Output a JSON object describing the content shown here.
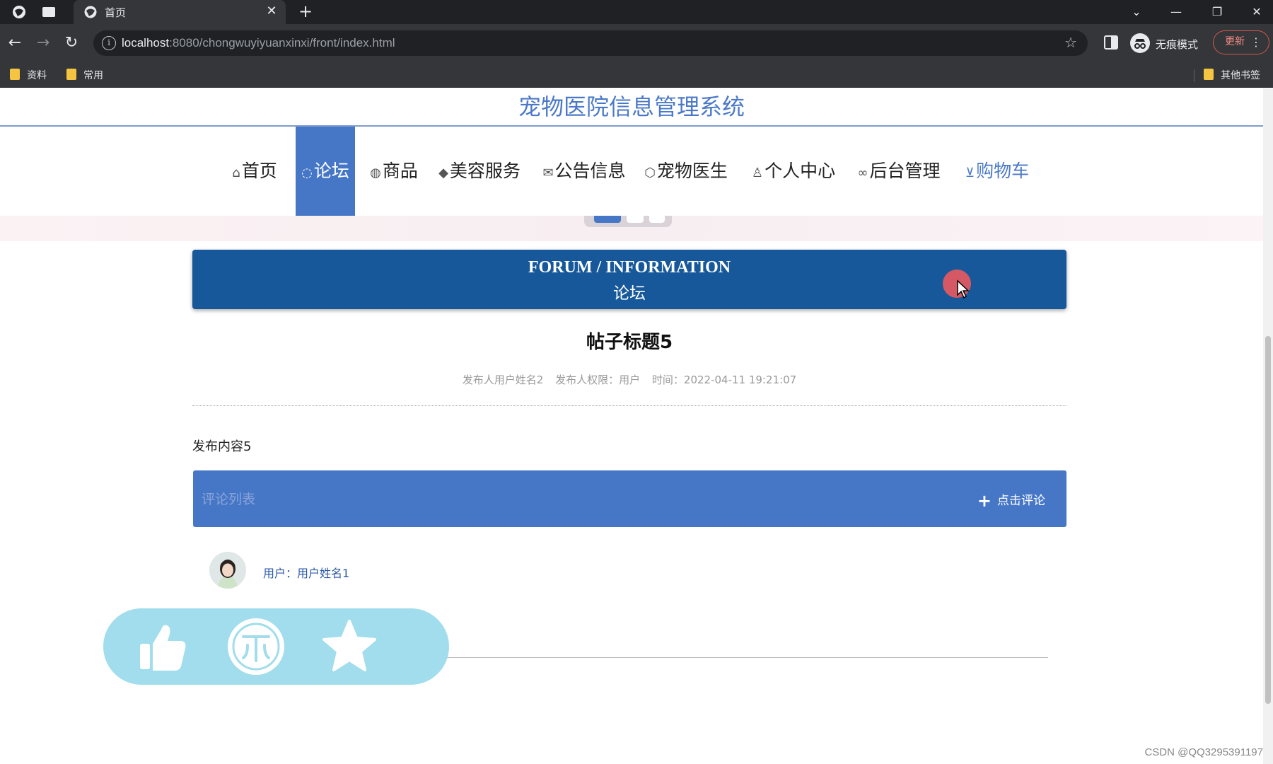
{
  "browser": {
    "tab_title": "首页",
    "url_host": "localhost",
    "url_rest": ":8080/chongwuyiyuanxinxi/front/index.html",
    "incognito_label": "无痕模式",
    "update_label": "更新",
    "bookmarks": [
      "资料",
      "常用"
    ],
    "other_bookmarks": "其他书签"
  },
  "site": {
    "title": "宠物医院信息管理系统"
  },
  "nav": [
    {
      "label": "首页",
      "icon": "home-icon",
      "active": false
    },
    {
      "label": "论坛",
      "icon": "chat-icon",
      "active": true
    },
    {
      "label": "商品",
      "icon": "palette-icon",
      "active": false
    },
    {
      "label": "美容服务",
      "icon": "graduation-icon",
      "active": false
    },
    {
      "label": "公告信息",
      "icon": "mail-icon",
      "active": false
    },
    {
      "label": "宠物医生",
      "icon": "cube-icon",
      "active": false
    },
    {
      "label": "个人中心",
      "icon": "user-icon",
      "active": false
    },
    {
      "label": "后台管理",
      "icon": "link-icon",
      "active": false
    },
    {
      "label": "购物车",
      "icon": "cart-icon",
      "active": false
    }
  ],
  "forum": {
    "heading_en": "FORUM / INFORMATION",
    "heading_cn": "论坛"
  },
  "post": {
    "title": "帖子标题5",
    "author": "发布人用户姓名2",
    "role": "发布人权限：用户",
    "time": "时间：2022-04-11 19:21:07",
    "content": "发布内容5"
  },
  "comments": {
    "bar_label": "评论列表",
    "add_label": "点击评论",
    "items": [
      {
        "user": "用户：用户姓名1"
      }
    ]
  },
  "actions": [
    "like-icon",
    "coin-icon",
    "star-icon"
  ],
  "watermark": "CSDN @QQ3295391197",
  "colors": {
    "accent": "#4677c7",
    "forum_header": "#16589a",
    "action_pill": "#a1ddec"
  }
}
